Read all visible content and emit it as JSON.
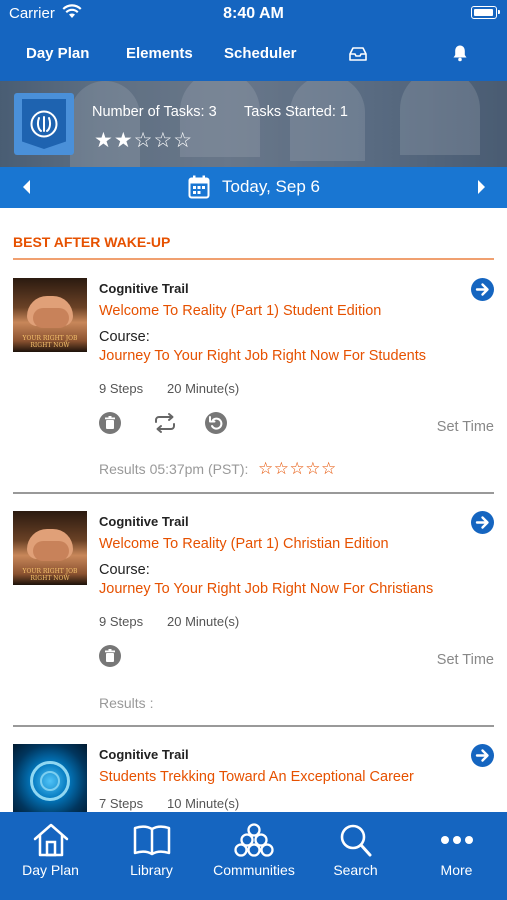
{
  "status_bar": {
    "carrier": "Carrier",
    "time": "8:40 AM"
  },
  "top_nav": {
    "tabs": [
      "Day Plan",
      "Elements",
      "Scheduler"
    ],
    "icons": [
      "inbox-icon",
      "bell-icon"
    ]
  },
  "summary": {
    "tasks_label": "Number of Tasks: 3",
    "started_label": "Tasks Started: 1",
    "stars_filled": 2,
    "stars_total": 5,
    "stars_text": "★★☆☆☆"
  },
  "date_bar": {
    "date": "Today, Sep 6"
  },
  "section": {
    "title": "BEST AFTER WAKE-UP"
  },
  "tasks": [
    {
      "kind": "Cognitive Trail",
      "title": "Welcome To Reality (Part 1) Student Edition",
      "course_label": "Course:",
      "course": "Journey To Your Right Job Right Now For Students",
      "steps": "9 Steps",
      "duration": "20 Minute(s)",
      "set_time": "Set Time",
      "results": "Results 05:37pm (PST):",
      "result_stars": "☆☆☆☆☆",
      "thumb_caption": "YOUR RIGHT JOB RIGHT NOW"
    },
    {
      "kind": "Cognitive Trail",
      "title": "Welcome To Reality (Part 1) Christian Edition",
      "course_label": "Course:",
      "course": "Journey To Your Right Job Right Now For Christians",
      "steps": "9 Steps",
      "duration": "20 Minute(s)",
      "set_time": "Set Time",
      "results": "Results :",
      "thumb_caption": "YOUR RIGHT JOB RIGHT NOW"
    },
    {
      "kind": "Cognitive Trail",
      "title": "Students Trekking Toward An Exceptional Career",
      "steps": "7 Steps",
      "duration": "10 Minute(s)"
    }
  ],
  "bottom_nav": [
    {
      "label": "Day Plan",
      "icon": "home-icon"
    },
    {
      "label": "Library",
      "icon": "book-icon"
    },
    {
      "label": "Communities",
      "icon": "communities-icon"
    },
    {
      "label": "Search",
      "icon": "search-icon"
    },
    {
      "label": "More",
      "icon": "more-icon"
    }
  ],
  "colors": {
    "primary": "#1565c0",
    "accent": "#e65100",
    "date_bar": "#1976d2"
  }
}
